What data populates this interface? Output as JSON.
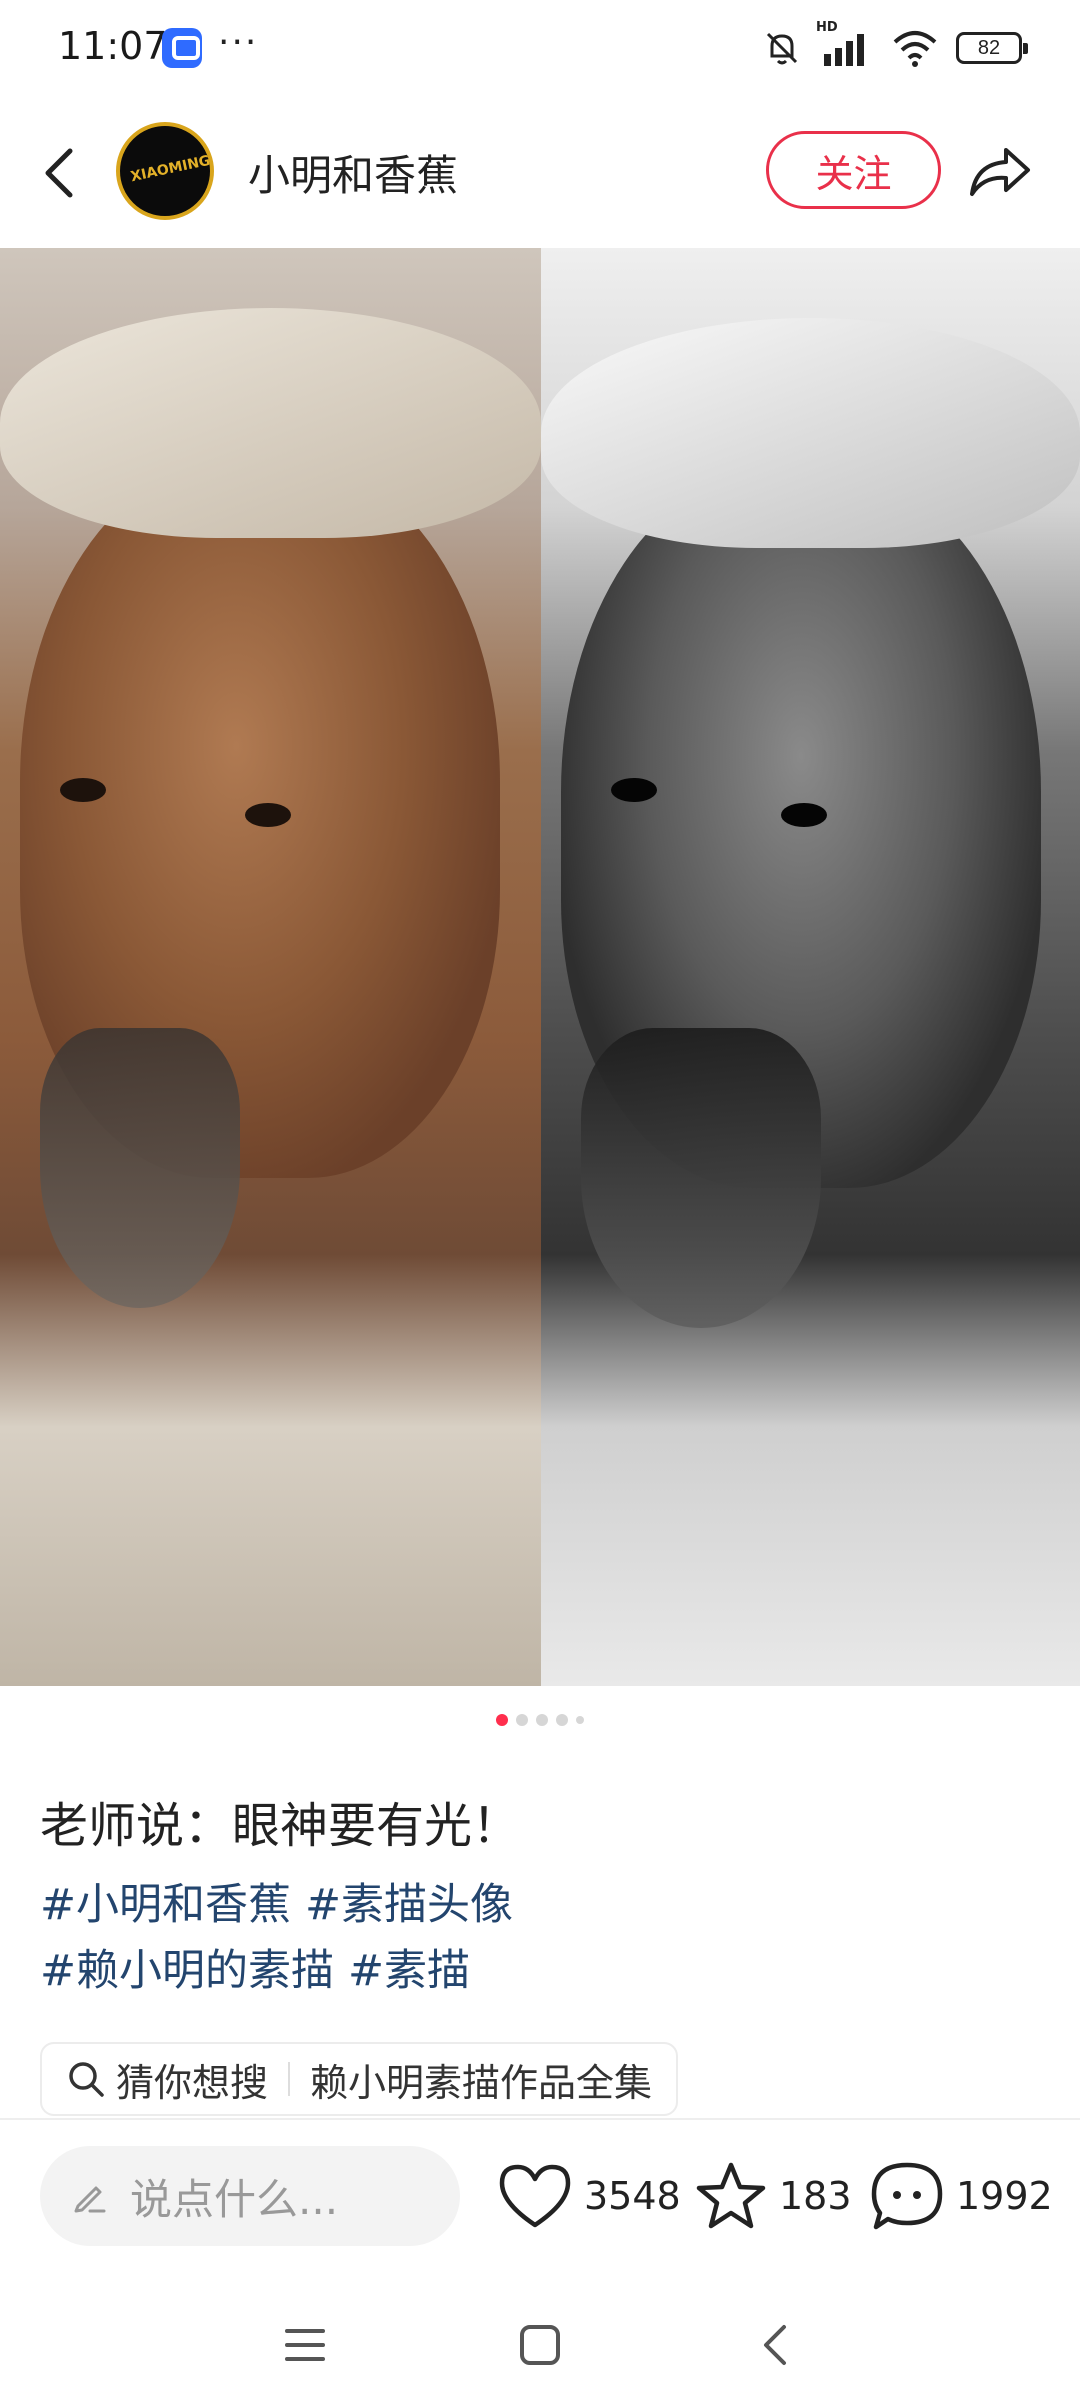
{
  "status_bar": {
    "time": "11:07",
    "more": "···",
    "network_label": "HD",
    "battery": "82"
  },
  "header": {
    "author_name": "小明和香蕉",
    "avatar_text": "XIAOMING",
    "follow_label": "关注"
  },
  "post": {
    "title": "老师说：眼神要有光！",
    "tags_line1": [
      "#小明和香蕉",
      "#素描头像"
    ],
    "tags_line2": [
      "#赖小明的素描",
      "#素描"
    ],
    "image_count": 5,
    "active_image": 1
  },
  "search_suggest": {
    "label": "猜你想搜",
    "query": "赖小明素描作品全集"
  },
  "bottom_bar": {
    "comment_placeholder": "说点什么...",
    "likes": "3548",
    "favorites": "183",
    "comments": "1992"
  },
  "colors": {
    "accent": "#e9304a",
    "tag": "#23456e"
  }
}
